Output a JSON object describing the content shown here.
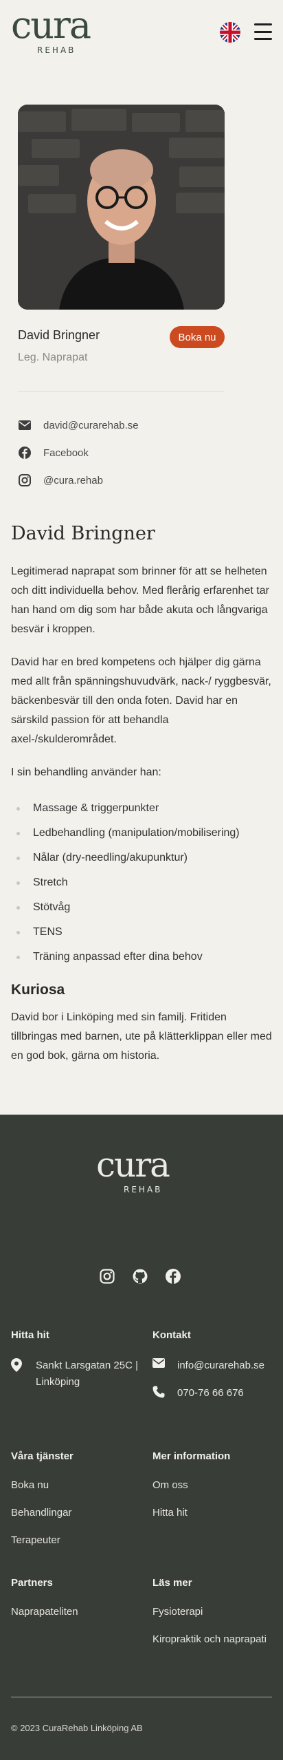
{
  "header": {
    "logo_word": "cura",
    "logo_sub": "REHAB",
    "language_flag": "uk-flag-icon",
    "menu_icon": "hamburger-menu-icon"
  },
  "profile": {
    "name": "David Bringner",
    "title": "Leg. Naprapat",
    "book_label": "Boka nu",
    "contacts": [
      {
        "icon": "mail-icon",
        "text": "david@curarehab.se"
      },
      {
        "icon": "facebook-icon",
        "text": "Facebook"
      },
      {
        "icon": "instagram-icon",
        "text": "@cura.rehab"
      }
    ]
  },
  "bio": {
    "heading": "David Bringner",
    "p1": "Legitimerad naprapat som brinner för att se helheten och ditt individuella behov. Med flerårig erfarenhet tar han hand om dig som har både akuta och långvariga besvär i kroppen.",
    "p2": "David har en bred kompetens och hjälper dig gärna med allt från spänningshuvudvärk, nack-/ ryggbesvär, bäckenbesvär till den onda foten. David har en särskild passion för att behandla axel-/skulderområdet.",
    "p3": "I sin behandling använder han:",
    "treatments": [
      "Massage & triggerpunkter",
      "Ledbehandling (manipulation/mobilisering)",
      "Nålar (dry-needling/akupunktur)",
      "Stretch",
      "Stötvåg",
      "TENS",
      "Träning anpassad efter dina behov"
    ],
    "trivia_heading": "Kuriosa",
    "trivia": "David bor i Linköping med sin familj. Fritiden tillbringas med barnen, ute på klätterklippan eller med en god bok, gärna om historia."
  },
  "footer": {
    "logo_word": "cura",
    "logo_sub": "REHAB",
    "social": [
      "instagram-icon",
      "github-icon",
      "facebook-icon"
    ],
    "find_heading": "Hitta hit",
    "address": "Sankt Larsgatan 25C | Linköping",
    "contact_heading": "Kontakt",
    "email": "info@curarehab.se",
    "phone": "070-76 66 676",
    "services_heading": "Våra tjänster",
    "services": [
      "Boka nu",
      "Behandlingar",
      "Terapeuter"
    ],
    "more_heading": "Mer information",
    "more": [
      "Om oss",
      "Hitta hit"
    ],
    "partners_heading": "Partners",
    "partners": [
      "Naprapateliten"
    ],
    "read_heading": "Läs mer",
    "read": [
      "Fysioterapi",
      "Kiropraktik och naprapati"
    ],
    "copyright": "© 2023 CuraRehab Linköping AB"
  },
  "colors": {
    "background": "#f2f1ec",
    "brand_green": "#3a4a3e",
    "accent_orange": "#cc4a1f",
    "footer_bg": "#383d37"
  }
}
